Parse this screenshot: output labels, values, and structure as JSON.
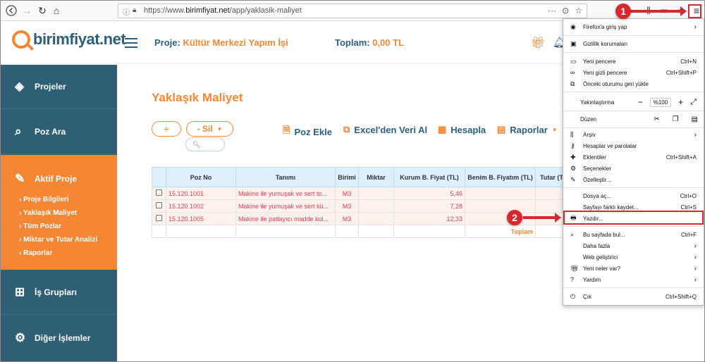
{
  "browser": {
    "url_prefix": "https://www.",
    "url_domain": "birimfiyat.net",
    "url_path": "/app/yaklasik-maliyet"
  },
  "header": {
    "logo": "birimfiyat.net",
    "proje_label": "Proje:",
    "proje_value": "Kültür Merkezi Yapım İşi",
    "toplam_label": "Toplam:",
    "toplam_value": "0,00 TL"
  },
  "sidebar": {
    "items": [
      {
        "label": "Projeler",
        "icon": "layers-icon"
      },
      {
        "label": "Poz Ara",
        "icon": "search-doc-icon"
      },
      {
        "label": "İş Grupları",
        "icon": "sitemap-icon"
      },
      {
        "label": "Diğer İşlemler",
        "icon": "gear-icon"
      }
    ],
    "active": {
      "label": "Aktif Proje",
      "sub": [
        "› Proje Bilgileri",
        "› Yaklaşık Maliyet",
        "› Tüm Pozlar",
        "› Miktar ve Tutar Analizi",
        "› Raporlar"
      ]
    }
  },
  "main": {
    "title": "Yaklaşık Maliyet",
    "plus_label": "+",
    "sil_label": "- Sil",
    "actions": [
      "Poz Ekle",
      "Excel'den Veri Al",
      "Hesapla",
      "Raporlar"
    ],
    "table": {
      "headers": [
        "",
        "Poz No",
        "Tanımı",
        "Birimi",
        "Miktar",
        "Kurum B. Fiyat (TL)",
        "Benim B. Fiyatım (TL)",
        "Tutar (T"
      ],
      "rows": [
        {
          "poz": "15.120.1001",
          "tanim": "Makine ile yumuşak ve sert to...",
          "birim": "M3",
          "miktar": "",
          "kurum": "5,46",
          "benim": "",
          "tutar": ""
        },
        {
          "poz": "15.120.1002",
          "tanim": "Makine ile yumuşak ve sert kü...",
          "birim": "M3",
          "miktar": "",
          "kurum": "7,28",
          "benim": "",
          "tutar": ""
        },
        {
          "poz": "15.120.1005",
          "tanim": "Makine ile patlayıcı madde kul...",
          "birim": "M3",
          "miktar": "",
          "kurum": "12,33",
          "benim": "",
          "tutar": ""
        }
      ],
      "total_label": "Toplam"
    }
  },
  "firefox_menu": {
    "signin": "Firefox'a giriş yap",
    "privacy": "Gizlilik korumaları",
    "new_window": {
      "label": "Yeni pencere",
      "shortcut": "Ctrl+N"
    },
    "private_window": {
      "label": "Yeni gizli pencere",
      "shortcut": "Ctrl+Shift+P"
    },
    "restore": "Önceki oturumu geri yükle",
    "zoom_label": "Yakınlaştırma",
    "zoom_value": "%100",
    "edit_label": "Düzen",
    "library": "Arşiv",
    "logins": "Hesaplar ve parolalar",
    "addons": {
      "label": "Eklentiler",
      "shortcut": "Ctrl+Shift+A"
    },
    "options": "Seçenekler",
    "customize": "Özelleştir...",
    "open_file": {
      "label": "Dosya aç...",
      "shortcut": "Ctrl+O"
    },
    "save_page": {
      "label": "Sayfayı farklı kaydet...",
      "shortcut": "Ctrl+S"
    },
    "print": "Yazdır...",
    "find": {
      "label": "Bu sayfada bul...",
      "shortcut": "Ctrl+F"
    },
    "more": "Daha fazla",
    "dev": "Web geliştirici",
    "whats_new": "Yeni neler var?",
    "help": "Yardım",
    "exit": {
      "label": "Çık",
      "shortcut": "Ctrl+Shift+Q"
    }
  },
  "annotations": {
    "badge1": "1",
    "badge2": "2",
    "color": "#d9272e"
  }
}
